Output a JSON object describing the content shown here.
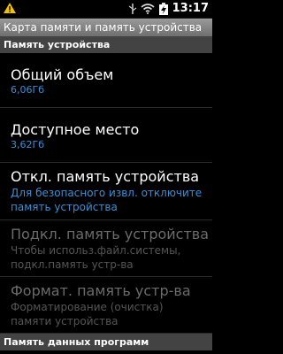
{
  "status": {
    "time": "13:17",
    "icons": [
      "warning-icon",
      "usb-icon",
      "wifi-icon",
      "battery-icon"
    ]
  },
  "title": "Карта памяти и память устройства",
  "sections": [
    {
      "header": "Память устройства",
      "items": [
        {
          "title": "Общий объем",
          "sub": "6,06Гб"
        },
        {
          "title": "Доступное место",
          "sub": "3,62Гб"
        },
        {
          "title": "Откл. память устройства",
          "sub": "Для безопасного извл. отключите память устройства"
        },
        {
          "title": "Подкл. память устройства",
          "sub": "Чтобы использ.файл.системы, подкл.память устр-ва"
        },
        {
          "title": "Формат. память устр-ва",
          "sub": "Форматирование (очистка) памяти устройства"
        }
      ]
    },
    {
      "header": "Память данных программ"
    }
  ],
  "colors": {
    "accent": "#3b8fd6",
    "disabled": "#6b6b6b",
    "header_bg": "#434343"
  }
}
